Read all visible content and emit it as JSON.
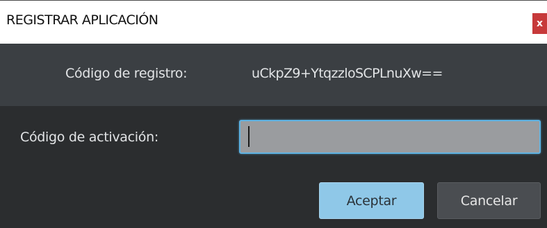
{
  "window": {
    "title": "REGISTRAR APLICACIÓN",
    "close_label": "x"
  },
  "registration": {
    "label": "Código de registro:",
    "value": "uCkpZ9+YtqzzloSCPLnuXw=="
  },
  "activation": {
    "label": "Código de activación:",
    "value": "",
    "placeholder": ""
  },
  "buttons": {
    "accept_label": "Aceptar",
    "cancel_label": "Cancelar"
  },
  "colors": {
    "titlebar_bg": "#ffffff",
    "close_bg": "#c7393a",
    "dialog_bg": "#2b2d2f",
    "registration_row_bg": "#3b3f43",
    "input_focus_border": "#5fb3e3",
    "accept_bg": "#8fc8e8",
    "cancel_bg": "#4a4d51"
  }
}
